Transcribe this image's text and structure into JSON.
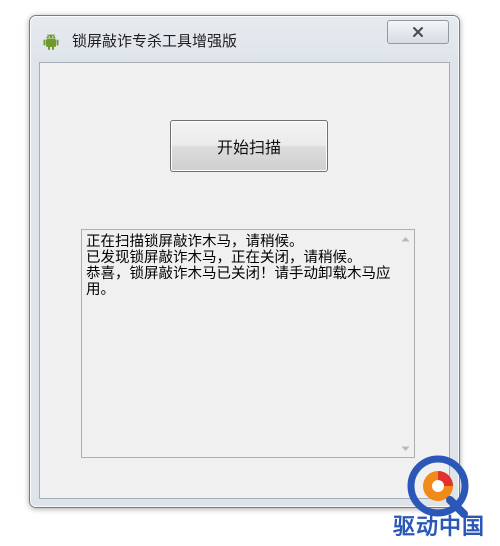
{
  "window": {
    "title": "锁屏敲诈专杀工具增强版"
  },
  "main": {
    "start_button_label": "开始扫描",
    "log_lines": [
      "正在扫描锁屏敲诈木马，请稍候。",
      "已发现锁屏敲诈木马，正在关闭，请稍候。",
      "恭喜，锁屏敲诈木马已关闭！请手动卸载木马应用。"
    ]
  },
  "watermark": {
    "text": "驱动中国"
  },
  "icons": {
    "app": "android-icon",
    "close": "close-icon",
    "scroll_up": "scroll-up-arrow-icon",
    "scroll_down": "scroll-down-arrow-icon",
    "watermark": "qd-logo-icon"
  },
  "colors": {
    "android_green": "#6f9b2e",
    "watermark_blue": "#2a57b8",
    "watermark_orange": "#f28a1b",
    "watermark_red": "#e2322e"
  }
}
